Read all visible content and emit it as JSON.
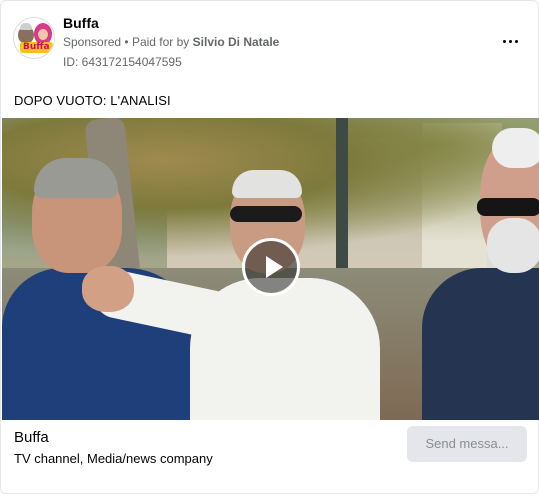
{
  "header": {
    "page_name": "Buffa",
    "sponsored_label": "Sponsored",
    "separator": "•",
    "paid_for_prefix": "Paid for by",
    "payer_name": "Silvio Di Natale",
    "ad_id": "ID: 643172154047595",
    "avatar_logo_text": "Buffa"
  },
  "post": {
    "text": "DOPO VUOTO: L'ANALISI"
  },
  "media": {
    "play_icon": "play-icon"
  },
  "footer": {
    "page_name": "Buffa",
    "category": "TV channel, Media/news company",
    "cta_label": "Send messa..."
  },
  "colors": {
    "secondary_text": "#65676b",
    "button_bg": "#e4e6eb",
    "button_text": "#8a8d91"
  }
}
